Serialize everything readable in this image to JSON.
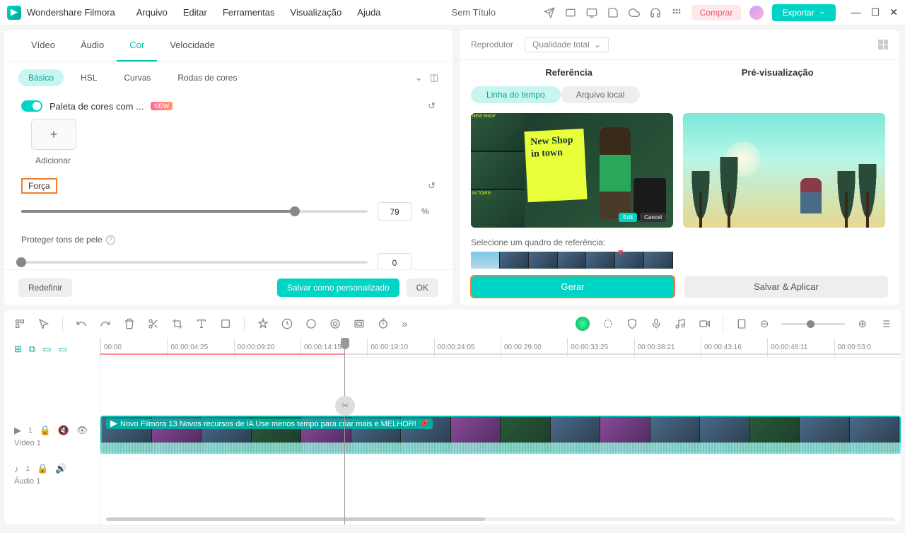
{
  "app": {
    "name": "Wondershare Filmora",
    "doc_title": "Sem Título"
  },
  "menu": [
    "Arquivo",
    "Editar",
    "Ferramentas",
    "Visualização",
    "Ajuda"
  ],
  "titlebar": {
    "buy": "Comprar",
    "export": "Exportar"
  },
  "tabs": {
    "video": "Vídeo",
    "audio": "Áudio",
    "color": "Cor",
    "speed": "Velocidade"
  },
  "subtabs": {
    "basic": "Básico",
    "hsl": "HSL",
    "curves": "Curvas",
    "wheels": "Rodas de cores"
  },
  "palette": {
    "label": "Paleta de cores com ...",
    "new": "NEW",
    "add": "Adicionar"
  },
  "force": {
    "label": "Força",
    "value": "79",
    "unit": "%"
  },
  "protect": {
    "label": "Proteger tons de pele",
    "value": "0"
  },
  "footer": {
    "reset": "Redefinir",
    "save_custom": "Salvar como personalizado",
    "ok": "OK"
  },
  "right": {
    "player": "Reprodutor",
    "quality": "Qualidade total",
    "ref_header": "Referência",
    "preview_header": "Pré-visualização",
    "timeline_pill": "Linha do tempo",
    "local_pill": "Arquivo local",
    "ref_note": "New Shop in town",
    "ref_edit": "Edit",
    "ref_cancel": "Cancel",
    "select_frame": "Selecione um quadro de referência:",
    "generate": "Gerar",
    "save_apply": "Salvar & Aplicar"
  },
  "timeline": {
    "ticks": [
      "00:00",
      "00:00:04:25",
      "00:00:09:20",
      "00:00:14:15",
      "00:00:19:10",
      "00:00:24:05",
      "00:00:29:00",
      "00:00:33:25",
      "00:00:38:21",
      "00:00:43:16",
      "00:00:48:11",
      "00:00:53:0"
    ],
    "clip_title": "Novo Filmora 13 Novos recursos de IA   Use menos tempo  para criar mais e MELHOR!",
    "video_track": "Vídeo 1",
    "audio_track": "Áudio 1"
  }
}
